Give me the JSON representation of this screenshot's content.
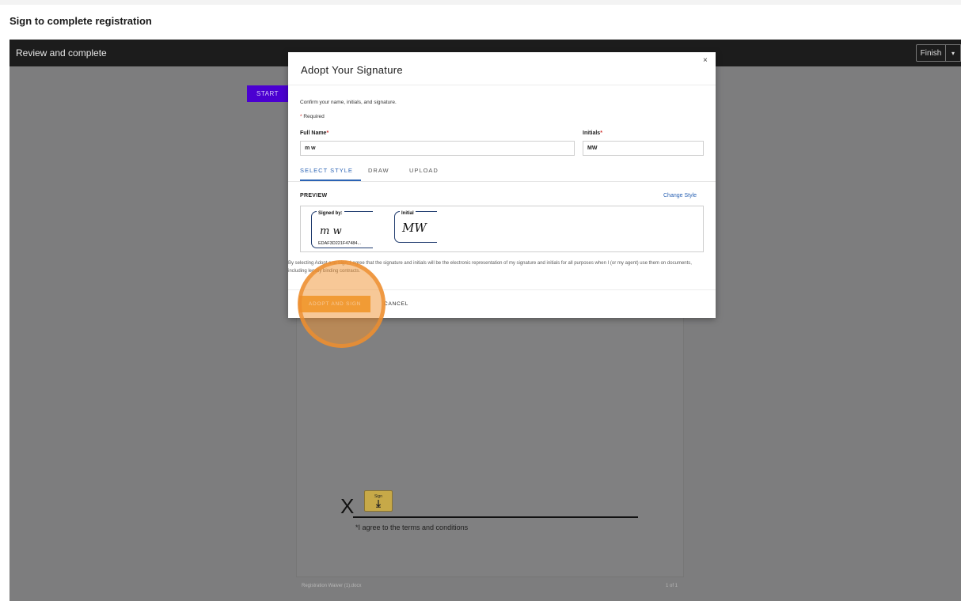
{
  "page": {
    "heading": "Sign to complete registration"
  },
  "viewer": {
    "title": "Review and complete",
    "finish_label": "Finish",
    "finish_caret": "▾",
    "start_label": "START"
  },
  "document": {
    "x_mark": "X",
    "sign_tab_label": "Sign",
    "sign_tab_arrow": "⤓",
    "agree_text": "*I agree to the terms and conditions",
    "footer_name": "Registration Waiver (1).docx",
    "footer_page": "1 of 1"
  },
  "modal": {
    "close": "×",
    "title": "Adopt Your Signature",
    "confirm_text": "Confirm your name, initials, and signature.",
    "required_star": "*",
    "required_text": " Required",
    "full_name_label": "Full Name",
    "initials_label": "Initials",
    "full_name_value": "m w",
    "initials_value": "MW",
    "tabs": {
      "select_style": "SELECT STYLE",
      "draw": "DRAW",
      "upload": "UPLOAD"
    },
    "preview_label": "PREVIEW",
    "change_style": "Change Style",
    "signature": {
      "signed_by_label": "Signed by:",
      "signature_text": "m w",
      "signature_id": "EDAF3D221F47484..."
    },
    "initial": {
      "label": "Initial",
      "initials_text": "MW"
    },
    "legal_text": "By selecting Adopt and Sign, I agree that the signature and initials will be the electronic representation of my signature and initials for all purposes when I (or my agent) use them on documents, including legally binding contracts.",
    "adopt_button": "ADOPT AND SIGN",
    "cancel_button": "CANCEL"
  },
  "colors": {
    "accent_blue": "#2b63b4",
    "adopt_orange": "#f3a53a",
    "start_purple": "#4b00d1",
    "required_red": "#d0312d"
  }
}
